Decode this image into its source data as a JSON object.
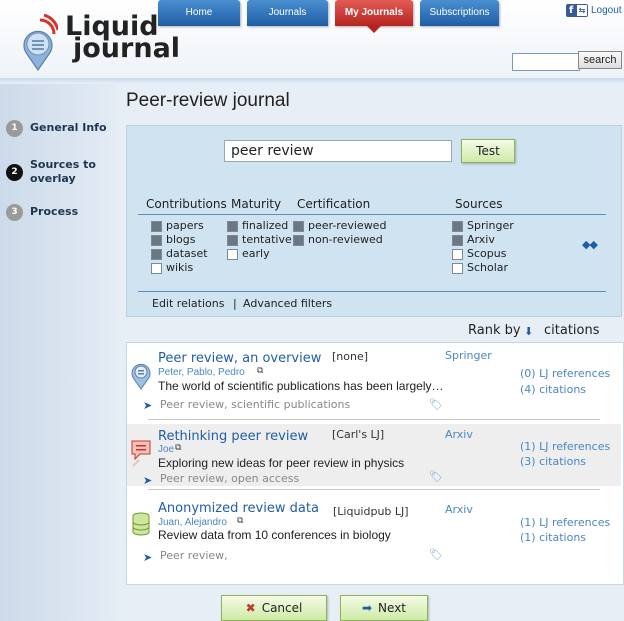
{
  "brand": {
    "line1": "Liquid",
    "line2": "journal"
  },
  "nav": {
    "tabs": [
      {
        "label": "Home"
      },
      {
        "label": "Journals"
      },
      {
        "label": "My Journals",
        "active": true
      },
      {
        "label": "Subscriptions"
      }
    ]
  },
  "account": {
    "logout_label": "Logout",
    "social_icon": "facebook-connect-icon"
  },
  "search": {
    "value": "",
    "button_label": "search"
  },
  "steps": [
    {
      "number": "1",
      "label": "General Info",
      "active": false
    },
    {
      "number": "2",
      "label": "Sources to overlay",
      "active": true
    },
    {
      "number": "3",
      "label": "Process",
      "active": false
    }
  ],
  "page": {
    "title": "Peer-review journal"
  },
  "query": {
    "value": "peer review",
    "test_label": "Test"
  },
  "filters": {
    "headers": {
      "contributions": "Contributions",
      "maturity": "Maturity",
      "certification": "Certification",
      "sources": "Sources"
    },
    "contributions": [
      {
        "label": "papers",
        "checked": true
      },
      {
        "label": "blogs",
        "checked": true
      },
      {
        "label": "dataset",
        "checked": true
      },
      {
        "label": "wikis",
        "checked": false
      }
    ],
    "maturity": [
      {
        "label": "finalized",
        "checked": true
      },
      {
        "label": "tentative",
        "checked": true
      },
      {
        "label": "early",
        "checked": false
      }
    ],
    "certification": [
      {
        "label": "peer-reviewed",
        "checked": true
      },
      {
        "label": "non-reviewed",
        "checked": true
      }
    ],
    "sources": [
      {
        "label": "Springer",
        "checked": true
      },
      {
        "label": "Arxiv",
        "checked": true
      },
      {
        "label": "Scopus",
        "checked": false
      },
      {
        "label": "Scholar",
        "checked": false
      }
    ],
    "edit_relations": "Edit relations",
    "separator": "|",
    "advanced_filters": "Advanced filters"
  },
  "rank": {
    "label": "Rank by",
    "value": "citations"
  },
  "results": [
    {
      "title": "Peer review, an overview",
      "tag": "[none]",
      "source": "Springer",
      "authors": "Peter, Pablo, Pedro",
      "description": "The world of scientific publications has been largely…",
      "keywords": "Peer review, scientific publications",
      "references": "(0) LJ references",
      "citations": "(4) citations",
      "type_icon": "blog-post-icon"
    },
    {
      "title": "Rethinking peer review",
      "tag": "[Carl's LJ]",
      "source": "Arxiv",
      "authors": "Joe",
      "description": "Exploring new ideas for peer review in physics",
      "keywords": "Peer review, open access",
      "references": "(1) LJ references",
      "citations": "(3) citations",
      "type_icon": "comment-icon"
    },
    {
      "title": "Anonymized review data",
      "tag": "[Liquidpub LJ]",
      "source": "Arxiv",
      "authors": "Juan, Alejandro",
      "description": "Review data from 10 conferences in biology",
      "keywords": "Peer review,",
      "references": "(1) LJ references",
      "citations": "(1) citations",
      "type_icon": "database-icon"
    }
  ],
  "actions": {
    "cancel_label": "Cancel",
    "next_label": "Next"
  }
}
